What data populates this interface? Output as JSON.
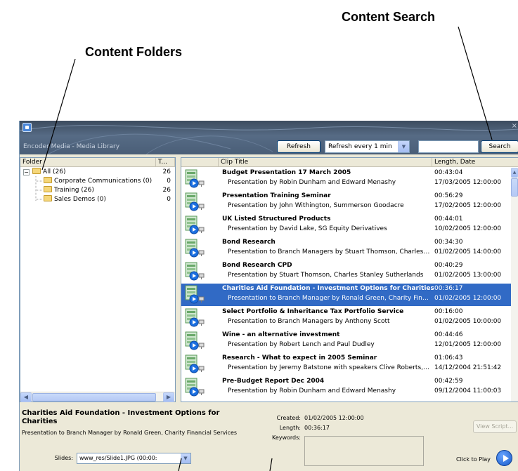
{
  "callouts": {
    "content_search": "Content Search",
    "content_folders": "Content Folders"
  },
  "window": {
    "title": "Encoder Media - Media Library",
    "close_glyph": "×",
    "refresh_label": "Refresh",
    "refresh_interval": "Refresh every 1 min",
    "search_value": "",
    "search_label": "Search"
  },
  "folders": {
    "columns": [
      "Folder",
      "T..."
    ],
    "items": [
      {
        "label": "All (26)",
        "count": "26",
        "expand": "−"
      },
      {
        "label": "Corporate Communications (0)",
        "count": "0"
      },
      {
        "label": "Training (26)",
        "count": "26"
      },
      {
        "label": "Sales Demos (0)",
        "count": "0"
      }
    ]
  },
  "clips": {
    "columns": [
      "Clip Title",
      "Length, Date"
    ],
    "rows": [
      {
        "title": "Budget Presentation 17 March 2005",
        "desc": "Presentation by Robin Dunham and Edward Menashy",
        "length": "00:43:04",
        "date": "17/03/2005 12:00:00"
      },
      {
        "title": "Presentation Training Seminar",
        "desc": "Presentation by John Withington, Summerson Goodacre",
        "length": "00:56:29",
        "date": "17/02/2005 12:00:00"
      },
      {
        "title": "UK Listed Structured Products",
        "desc": "Presentation by David Lake, SG Equity Derivatives",
        "length": "00:44:01",
        "date": "10/02/2005 12:00:00"
      },
      {
        "title": "Bond Research",
        "desc": "Presentation to Branch Managers by Stuart Thomson, Charles Sta...",
        "length": "00:34:30",
        "date": "01/02/2005 14:00:00"
      },
      {
        "title": "Bond Research CPD",
        "desc": "Presentation by Stuart Thomson, Charles Stanley Sutherlands",
        "length": "00:40:29",
        "date": "01/02/2005 13:00:00"
      },
      {
        "title": "Charities Aid Foundation - Investment Options for Charities",
        "desc": "Presentation to Branch Manager by Ronald Green, Charity Financi...",
        "length": "00:36:17",
        "date": "01/02/2005 12:00:00",
        "selected": true
      },
      {
        "title": "Select Portfolio & Inheritance Tax Portfolio Service",
        "desc": "Presentation to Branch Managers by Anthony Scott",
        "length": "00:16:00",
        "date": "01/02/2005 10:00:00"
      },
      {
        "title": "Wine - an alternative investment",
        "desc": "Presentation by Robert Lench and Paul Dudley",
        "length": "00:44:46",
        "date": "12/01/2005 12:00:00"
      },
      {
        "title": "Research - What to expect in 2005 Seminar",
        "desc": "Presentation by Jeremy Batstone with speakers Clive Roberts, Ni...",
        "length": "01:06:43",
        "date": "14/12/2004 21:51:42"
      },
      {
        "title": "Pre-Budget Report Dec 2004",
        "desc": "Presentation by Robin Dunham and Edward Menashy",
        "length": "00:42:59",
        "date": "09/12/2004 11:00:03"
      }
    ]
  },
  "detail": {
    "title": "Charities Aid Foundation - Investment Options for Charities",
    "description": "Presentation to Branch Manager by Ronald Green, Charity Financial Services",
    "created_label": "Created:",
    "created_value": "01/02/2005 12:00:00",
    "length_label": "Length:",
    "length_value": "00:36:17",
    "keywords_label": "Keywords:",
    "slides_label": "Slides:",
    "slides_value": "www_res/Slide1.JPG  (00:00:",
    "view_script_label": "View Script...",
    "play_label": "Click to Play"
  },
  "colors": {
    "selection": "#316ac5",
    "title_bar": "#4a5e77",
    "panel_border": "#7f9db9"
  }
}
